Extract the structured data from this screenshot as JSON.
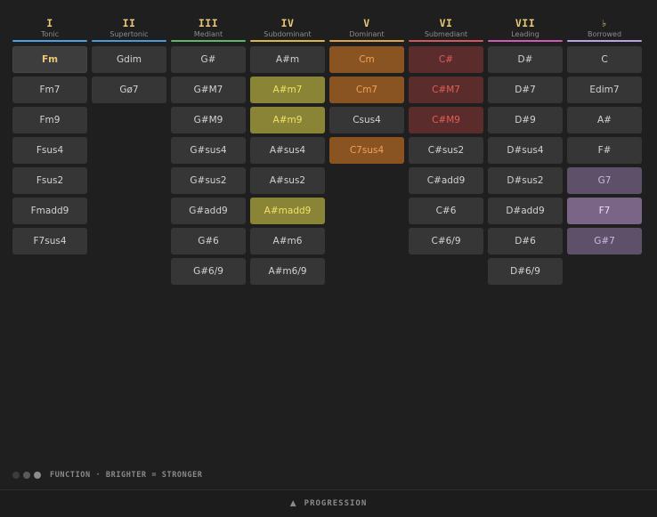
{
  "colors": {
    "background": "#1f1f1f",
    "tile": "#363636",
    "tonic": "#4aa3e0",
    "supertonic": "#4aa3e0",
    "mediant": "#5fb86a",
    "subdominant": "#d9b84a",
    "dominant": "#e0a34a",
    "submediant": "#d9545c",
    "leading": "#d05ab5",
    "borrowed": "#b9a3e8",
    "numeral": "#e8c876"
  },
  "columns": [
    {
      "numeral": "I",
      "name": "Tonic",
      "line_color": "#4aa3e0",
      "chords": [
        {
          "label": "Fm",
          "style": "selected"
        },
        {
          "label": "Fm7",
          "style": ""
        },
        {
          "label": "Fm9",
          "style": ""
        },
        {
          "label": "Fsus4",
          "style": ""
        },
        {
          "label": "Fsus2",
          "style": ""
        },
        {
          "label": "Fmadd9",
          "style": ""
        },
        {
          "label": "F7sus4",
          "style": ""
        }
      ]
    },
    {
      "numeral": "II",
      "name": "Supertonic",
      "line_color": "#4a9ad8",
      "chords": [
        {
          "label": "Gdim",
          "style": ""
        },
        {
          "label": "Gø7",
          "style": ""
        }
      ]
    },
    {
      "numeral": "III",
      "name": "Mediant",
      "line_color": "#5fb86a",
      "chords": [
        {
          "label": "G#",
          "style": ""
        },
        {
          "label": "G#M7",
          "style": ""
        },
        {
          "label": "G#M9",
          "style": ""
        },
        {
          "label": "G#sus4",
          "style": ""
        },
        {
          "label": "G#sus2",
          "style": ""
        },
        {
          "label": "G#add9",
          "style": ""
        },
        {
          "label": "G#6",
          "style": ""
        },
        {
          "label": "G#6/9",
          "style": ""
        }
      ]
    },
    {
      "numeral": "IV",
      "name": "Subdominant",
      "line_color": "#d9b84a",
      "chords": [
        {
          "label": "A#m",
          "style": ""
        },
        {
          "label": "A#m7",
          "style": "yellow"
        },
        {
          "label": "A#m9",
          "style": "yellow"
        },
        {
          "label": "A#sus4",
          "style": ""
        },
        {
          "label": "A#sus2",
          "style": ""
        },
        {
          "label": "A#madd9",
          "style": "yellow"
        },
        {
          "label": "A#m6",
          "style": ""
        },
        {
          "label": "A#m6/9",
          "style": ""
        }
      ]
    },
    {
      "numeral": "V",
      "name": "Dominant",
      "line_color": "#e0a34a",
      "chords": [
        {
          "label": "Cm",
          "style": "orange"
        },
        {
          "label": "Cm7",
          "style": "orange"
        },
        {
          "label": "Csus4",
          "style": ""
        },
        {
          "label": "C7sus4",
          "style": "orange"
        }
      ]
    },
    {
      "numeral": "VI",
      "name": "Submediant",
      "line_color": "#d9545c",
      "chords": [
        {
          "label": "C#",
          "style": "red"
        },
        {
          "label": "C#M7",
          "style": "red"
        },
        {
          "label": "C#M9",
          "style": "red"
        },
        {
          "label": "C#sus2",
          "style": ""
        },
        {
          "label": "C#add9",
          "style": ""
        },
        {
          "label": "C#6",
          "style": ""
        },
        {
          "label": "C#6/9",
          "style": ""
        }
      ]
    },
    {
      "numeral": "VII",
      "name": "Leading",
      "line_color": "#d05ab5",
      "chords": [
        {
          "label": "D#",
          "style": ""
        },
        {
          "label": "D#7",
          "style": ""
        },
        {
          "label": "D#9",
          "style": ""
        },
        {
          "label": "D#sus4",
          "style": ""
        },
        {
          "label": "D#sus2",
          "style": ""
        },
        {
          "label": "D#add9",
          "style": ""
        },
        {
          "label": "D#6",
          "style": ""
        },
        {
          "label": "D#6/9",
          "style": ""
        }
      ]
    },
    {
      "numeral": "♭",
      "name": "Borrowed",
      "line_color": "#b9a3e8",
      "chords": [
        {
          "label": "C",
          "style": ""
        },
        {
          "label": "Edim7",
          "style": ""
        },
        {
          "label": "A#",
          "style": ""
        },
        {
          "label": "F#",
          "style": ""
        },
        {
          "label": "G7",
          "style": "purple"
        },
        {
          "label": "F7",
          "style": "purple-strong"
        },
        {
          "label": "G#7",
          "style": "purple"
        }
      ]
    }
  ],
  "legend": {
    "text": "FUNCTION · BRIGHTER = STRONGER",
    "dots": [
      "#3c3c3c",
      "#5a5a5a",
      "#8c8c8c"
    ]
  },
  "footer": {
    "arrow": "▲",
    "label": "PROGRESSION"
  }
}
